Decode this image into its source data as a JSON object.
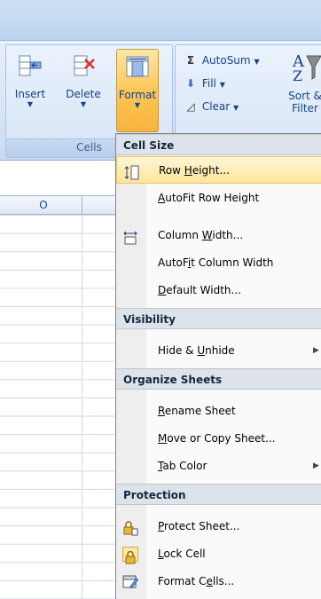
{
  "ribbon": {
    "cells": {
      "insert_label": "Insert",
      "delete_label": "Delete",
      "format_label": "Format",
      "group_label": "Cells"
    },
    "editing": {
      "autosum_label": "AutoSum",
      "fill_label": "Fill",
      "clear_label": "Clear",
      "sort_label_line1": "Sort &",
      "sort_label_line2": "Filter"
    }
  },
  "sheet": {
    "column_header": "O"
  },
  "menu": {
    "sections": {
      "cell_size": "Cell Size",
      "visibility": "Visibility",
      "organize": "Organize Sheets",
      "protection": "Protection"
    },
    "items": {
      "row_height": {
        "pre": "Row ",
        "key": "H",
        "post": "eight..."
      },
      "autofit_row": {
        "pre": "",
        "key": "A",
        "post": "utoFit Row Height"
      },
      "column_width": {
        "pre": "Column ",
        "key": "W",
        "post": "idth..."
      },
      "autofit_col": {
        "pre": "AutoF",
        "key": "i",
        "post": "t Column Width"
      },
      "default_width": {
        "pre": "",
        "key": "D",
        "post": "efault Width..."
      },
      "hide_unhide": {
        "pre": "Hide & ",
        "key": "U",
        "post": "nhide"
      },
      "rename": {
        "pre": "",
        "key": "R",
        "post": "ename Sheet"
      },
      "move_copy": {
        "pre": "",
        "key": "M",
        "post": "ove or Copy Sheet..."
      },
      "tab_color": {
        "pre": "",
        "key": "T",
        "post": "ab Color"
      },
      "protect": {
        "pre": "",
        "key": "P",
        "post": "rotect Sheet..."
      },
      "lock": {
        "pre": "",
        "key": "L",
        "post": "ock Cell"
      },
      "format_cells": {
        "pre": "Format C",
        "key": "e",
        "post": "lls..."
      }
    },
    "submenu_arrow": "▶"
  }
}
